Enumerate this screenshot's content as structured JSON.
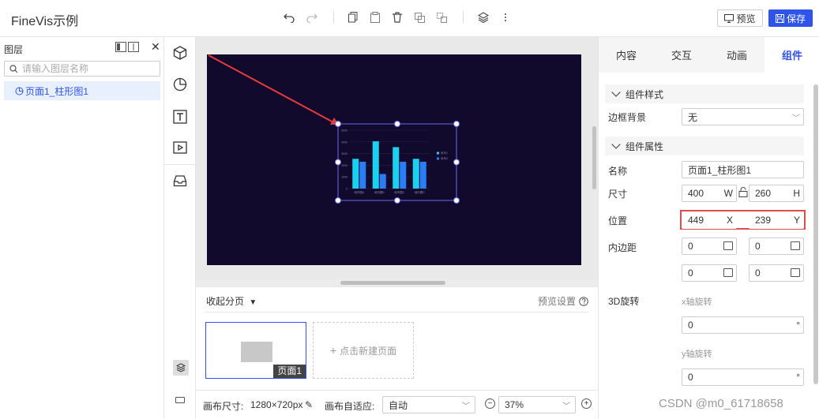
{
  "app": {
    "title": "FineVis示例"
  },
  "toolbar": {
    "icons": [
      "undo-icon",
      "redo-icon",
      "copy-icon",
      "paste-icon",
      "delete-icon",
      "group-icon",
      "ungroup-icon",
      "layers-icon",
      "more-icon"
    ],
    "preview_label": "预览",
    "save_label": "保存",
    "accent_color": "#2f54eb"
  },
  "layer_panel": {
    "title": "图层",
    "search_placeholder": "请输入图层名称",
    "items": [
      {
        "label": "页面1_柱形图1",
        "selected": true
      }
    ]
  },
  "icon_bar": {
    "icons": [
      "component-icon",
      "chart-icon",
      "text-icon",
      "media-icon",
      "inbox-icon",
      "layers-toggle-icon",
      "keyboard-icon"
    ]
  },
  "canvas": {
    "background": "#110a2c",
    "chart_data": {
      "type": "bar",
      "categories": [
        "地市图A",
        "地市图B",
        "地市图C",
        "地市图D"
      ],
      "series": [
        {
          "name": "系列1",
          "values": [
            2550,
            4050,
            3550,
            2550
          ],
          "color": "#1ad1f0"
        },
        {
          "name": "系列2",
          "values": [
            2300,
            1250,
            2300,
            2300
          ],
          "color": "#2a7df5"
        }
      ],
      "y_ticks": [
        "0",
        "1000",
        "2000",
        "3000",
        "4000",
        "5000"
      ],
      "ylim": [
        0,
        5000
      ],
      "legend": "right"
    }
  },
  "pages": {
    "collapse_label": "收起分页",
    "preview_settings": "预览设置",
    "page_badge": "页面1",
    "new_page_label": "点击新建页面"
  },
  "bottom_bar": {
    "canvas_size_label": "画布尺寸:",
    "canvas_size_value": "1280×720px",
    "adapt_label": "画布自适应:",
    "adapt_value": "自动",
    "zoom_value": "37%"
  },
  "right_panel": {
    "tabs": [
      "内容",
      "交互",
      "动画",
      "组件"
    ],
    "active_tab": "组件",
    "section_style": "组件样式",
    "border_bg_label": "边框背景",
    "border_bg_value": "无",
    "section_props": "组件属性",
    "name_label": "名称",
    "name_value": "页面1_柱形图1",
    "size_label": "尺寸",
    "width_value": "400",
    "width_suffix": "W",
    "height_value": "260",
    "height_suffix": "H",
    "position_label": "位置",
    "x_value": "449",
    "x_suffix": "X",
    "y_value": "239",
    "y_suffix": "Y",
    "padding_label": "内边距",
    "padding_top": "0",
    "padding_bottom": "0",
    "padding_left": "0",
    "padding_right": "0",
    "rotate_label": "3D旋转",
    "x_rotate_label": "x轴旋转",
    "x_rotate_value": "0",
    "y_rotate_label": "y轴旋转",
    "y_rotate_value": "0",
    "degree_suffix": "°"
  },
  "watermark": "CSDN @m0_61718658"
}
